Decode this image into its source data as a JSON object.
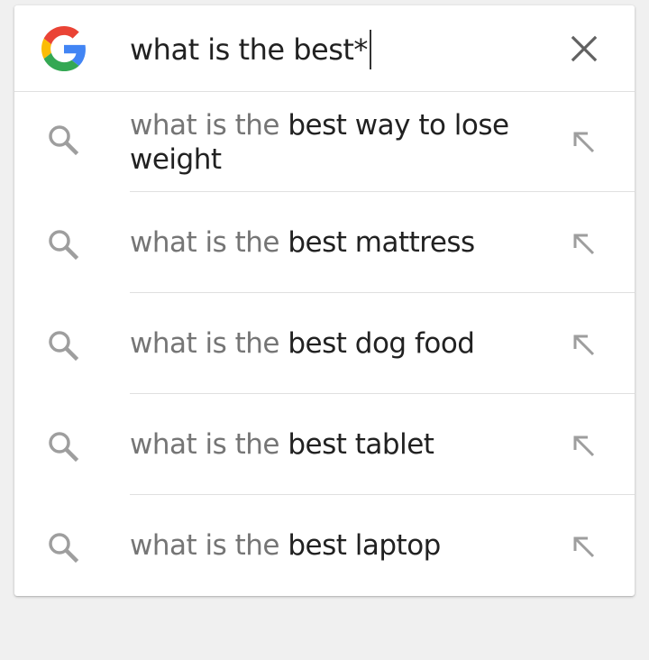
{
  "search": {
    "query": "what is the best*",
    "logo": "google-g-logo",
    "clear_icon": "close-icon"
  },
  "suggestions": [
    {
      "prefix": "what is the ",
      "completion": "best way to lose weight"
    },
    {
      "prefix": "what is the ",
      "completion": "best mattress"
    },
    {
      "prefix": "what is the ",
      "completion": "best dog food"
    },
    {
      "prefix": "what is the ",
      "completion": "best tablet"
    },
    {
      "prefix": "what is the ",
      "completion": "best laptop"
    }
  ],
  "icons": {
    "suggestion_icon": "search-icon",
    "fill_icon": "arrow-up-left-icon"
  },
  "colors": {
    "google_blue": "#4285F4",
    "google_red": "#EA4335",
    "google_yellow": "#FBBC05",
    "google_green": "#34A853",
    "prefix_text": "#757575",
    "completion_text": "#212121",
    "icon_gray": "#9e9e9e"
  }
}
